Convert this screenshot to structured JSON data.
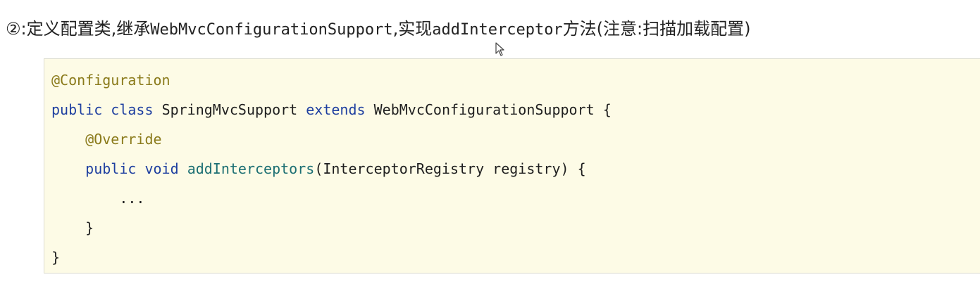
{
  "heading": {
    "marker": "②",
    "prefix": ":定义配置类,继承",
    "class_name": "WebMvcConfigurationSupport",
    "middle": ",实现",
    "method_name": "addInterceptor",
    "suffix": "方法(注意:扫描加载配置)"
  },
  "colors": {
    "keyword": "#1e3fa0",
    "annotation": "#8a7a1a",
    "method": "#1c6f73",
    "code_background": "#fdfbe6"
  },
  "code": {
    "line1": {
      "annotation": "@Configuration"
    },
    "line2": {
      "kw1": "public",
      "kw2": "class",
      "name": "SpringMvcSupport",
      "kw3": "extends",
      "parent": "WebMvcConfigurationSupport",
      "brace": "{"
    },
    "line3": {
      "annotation": "@Override"
    },
    "line4": {
      "kw1": "public",
      "kw2": "void",
      "method": "addInterceptors",
      "params": "(InterceptorRegistry registry) {"
    },
    "line5": {
      "text": "..."
    },
    "line6": {
      "text": "}"
    },
    "line7": {
      "text": "}"
    }
  }
}
